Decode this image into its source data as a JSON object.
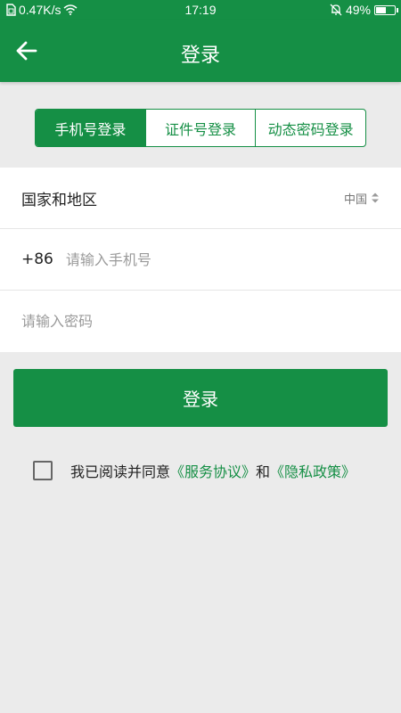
{
  "status_bar": {
    "net_speed": "0.47K/s",
    "time": "17:19",
    "battery": "49%",
    "battery_level": 0.49
  },
  "header": {
    "title": "登录"
  },
  "login_tabs": [
    {
      "label": "手机号登录",
      "active": true
    },
    {
      "label": "证件号登录",
      "active": false
    },
    {
      "label": "动态密码登录",
      "active": false
    }
  ],
  "form": {
    "region_label": "国家和地区",
    "region_value": "中国",
    "phone_code": "+86",
    "phone_placeholder": "请输入手机号",
    "password_placeholder": "请输入密码"
  },
  "login_button": "登录",
  "agreement": {
    "prefix": "我已阅读并同意",
    "service_link": "《服务协议》",
    "and": "和",
    "privacy_link": "《隐私政策》"
  },
  "colors": {
    "accent": "#158f45",
    "background": "#ebebeb"
  }
}
